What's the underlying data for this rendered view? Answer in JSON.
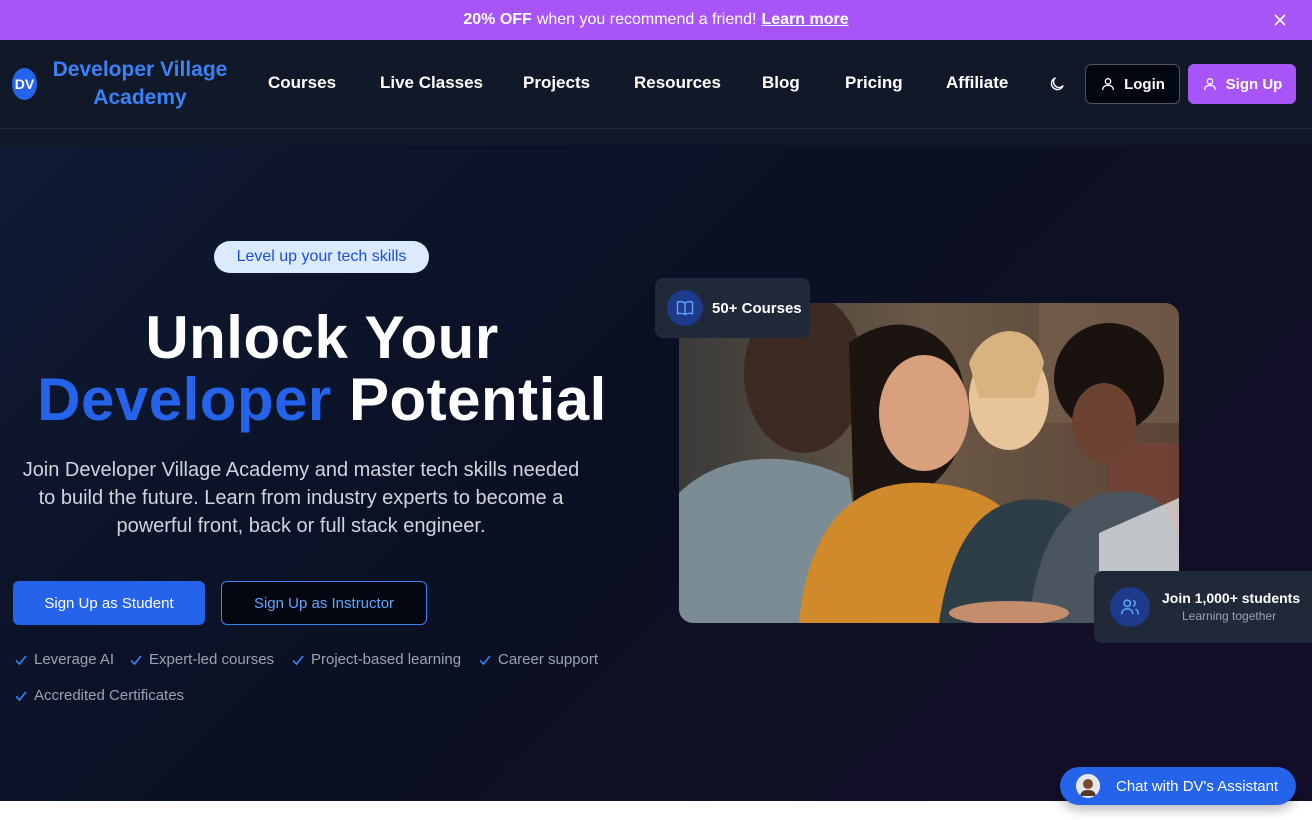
{
  "promo": {
    "highlight": "20% OFF",
    "text": "when you recommend a friend!",
    "link": "Learn more"
  },
  "header": {
    "logo_initials": "DV",
    "brand_line1": "Developer Village",
    "brand_line2": "Academy",
    "nav": [
      "Courses",
      "Live Classes",
      "Projects",
      "Resources",
      "Blog",
      "Pricing",
      "Affiliate"
    ],
    "login": "Login",
    "signup": "Sign Up"
  },
  "hero": {
    "pill": "Level up your tech skills",
    "title_line1": "Unlock Your",
    "title_blue": "Developer",
    "title_rest": "Potential",
    "lead": "Join Developer Village Academy and master tech skills needed to build the future. Learn from industry experts to become a powerful front, back or full stack engineer.",
    "cta_student": "Sign Up as Student",
    "cta_instructor": "Sign Up as Instructor",
    "features": [
      "Leverage AI",
      "Expert-led courses",
      "Project-based learning",
      "Career support",
      "Accredited Certificates"
    ],
    "courses_badge": "50+ Courses",
    "students_badge_title": "Join 1,000+ students",
    "students_badge_sub": "Learning together"
  },
  "chat": {
    "label": "Chat with DV's Assistant"
  },
  "colors": {
    "accent_purple": "#a855f7",
    "accent_blue": "#2563eb",
    "nav_bg": "#111827",
    "hero_bg": "#0b1024"
  }
}
